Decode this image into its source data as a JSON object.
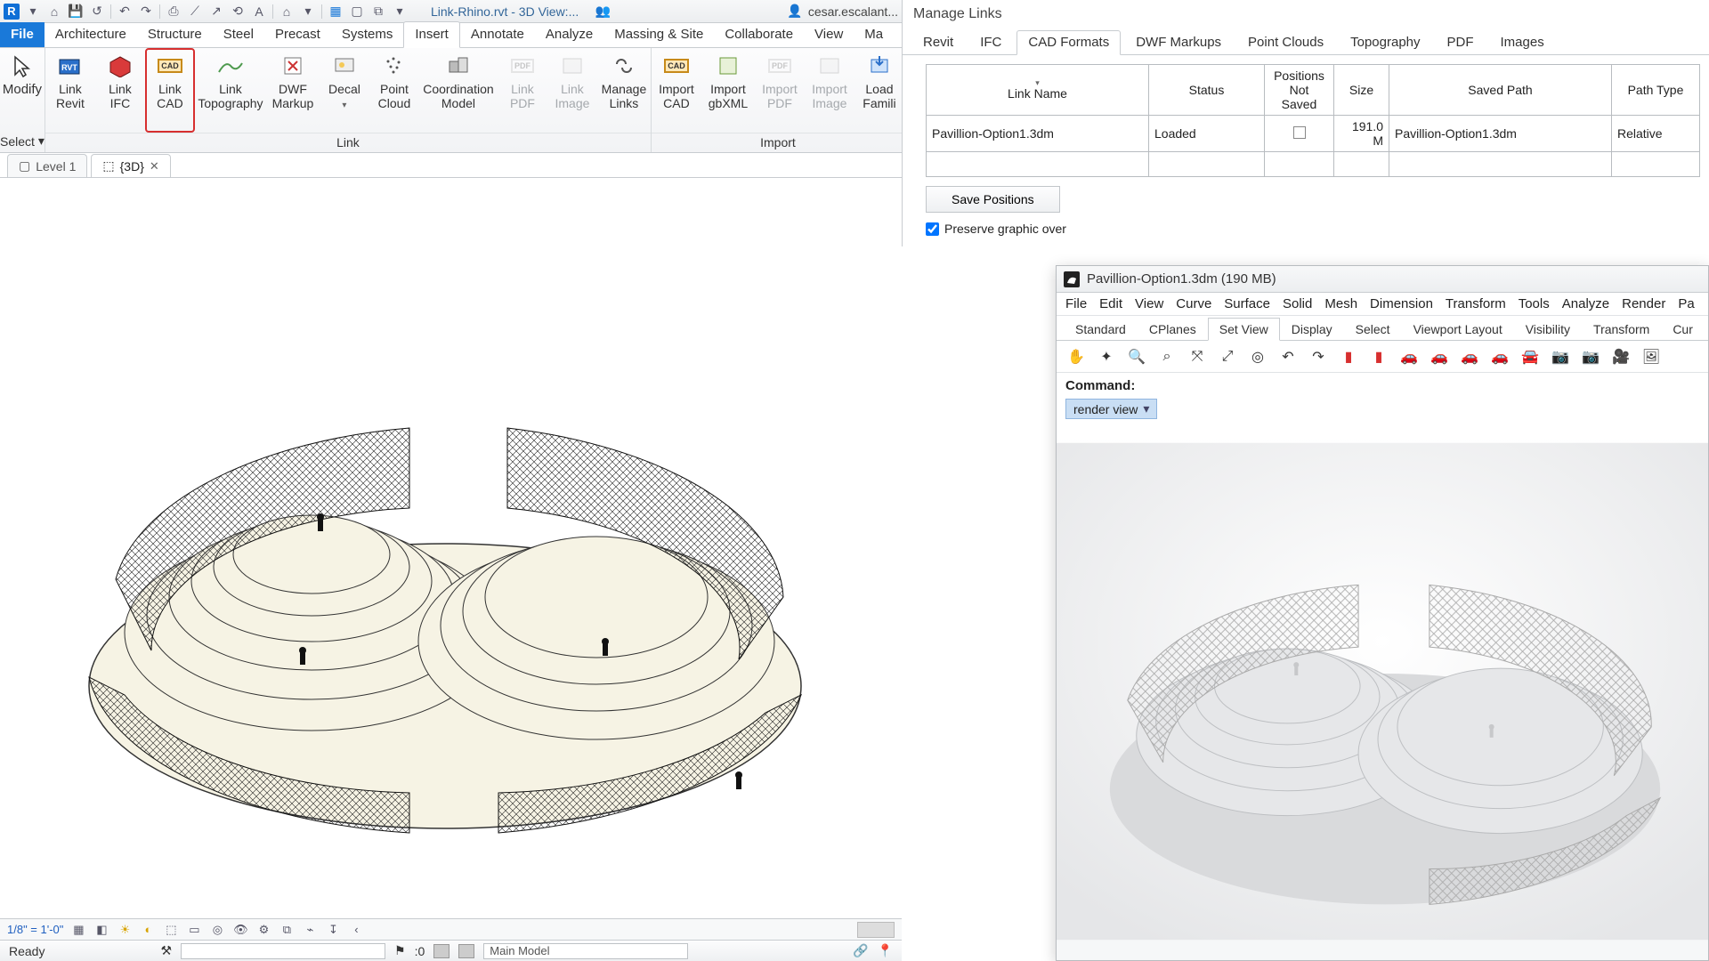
{
  "revit": {
    "qat": {
      "doc_title": "Link-Rhino.rvt - 3D View:...",
      "user": "cesar.escalant..."
    },
    "tabs": {
      "file": "File",
      "list": [
        "Architecture",
        "Structure",
        "Steel",
        "Precast",
        "Systems",
        "Insert",
        "Annotate",
        "Analyze",
        "Massing & Site",
        "Collaborate",
        "View",
        "Ma"
      ],
      "active": "Insert"
    },
    "select_panel": {
      "modify": "Modify",
      "select": "Select"
    },
    "link_group": {
      "label": "Link",
      "buttons": [
        {
          "l1": "Link",
          "l2": "Revit"
        },
        {
          "l1": "Link",
          "l2": "IFC"
        },
        {
          "l1": "Link",
          "l2": "CAD",
          "hl": true
        },
        {
          "l1": "Link",
          "l2": "Topography"
        },
        {
          "l1": "DWF",
          "l2": "Markup"
        },
        {
          "l1": "Decal",
          "l2": ""
        },
        {
          "l1": "Point",
          "l2": "Cloud"
        },
        {
          "l1": "Coordination",
          "l2": "Model"
        },
        {
          "l1": "Link",
          "l2": "PDF",
          "dim": true
        },
        {
          "l1": "Link",
          "l2": "Image",
          "dim": true
        },
        {
          "l1": "Manage",
          "l2": "Links"
        }
      ]
    },
    "import_group": {
      "label": "Import",
      "buttons": [
        {
          "l1": "Import",
          "l2": "CAD"
        },
        {
          "l1": "Import",
          "l2": "gbXML"
        },
        {
          "l1": "Import",
          "l2": "PDF",
          "dim": true
        },
        {
          "l1": "Import",
          "l2": "Image",
          "dim": true
        },
        {
          "l1": "Load",
          "l2": "Famili"
        }
      ]
    },
    "view_tabs": {
      "level1": "Level 1",
      "threeD": "{3D}"
    },
    "view_controls": {
      "scale": "1/8\" = 1'-0\"",
      "zero": ":0"
    },
    "status": {
      "ready": "Ready",
      "model": "Main Model"
    }
  },
  "manage_links": {
    "title": "Manage Links",
    "tabs": [
      "Revit",
      "IFC",
      "CAD Formats",
      "DWF Markups",
      "Point Clouds",
      "Topography",
      "PDF",
      "Images"
    ],
    "active_tab": "CAD Formats",
    "columns": {
      "name": "Link Name",
      "status": "Status",
      "pos": "Positions\nNot Saved",
      "size": "Size",
      "path": "Saved Path",
      "ptype": "Path Type"
    },
    "row": {
      "name": "Pavillion-Option1.3dm",
      "status": "Loaded",
      "pos": "",
      "size": "191.0 M",
      "path": "Pavillion-Option1.3dm",
      "ptype": "Relative"
    },
    "save_positions": "Save Positions",
    "preserve": "Preserve graphic over"
  },
  "rhino": {
    "title": "Pavillion-Option1.3dm (190 MB)",
    "menus": [
      "File",
      "Edit",
      "View",
      "Curve",
      "Surface",
      "Solid",
      "Mesh",
      "Dimension",
      "Transform",
      "Tools",
      "Analyze",
      "Render",
      "Pa"
    ],
    "tool_tabs": [
      "Standard",
      "CPlanes",
      "Set View",
      "Display",
      "Select",
      "Viewport Layout",
      "Visibility",
      "Transform",
      "Cur"
    ],
    "active_tool_tab": "Set View",
    "command_label": "Command:",
    "command_value": "render view"
  }
}
